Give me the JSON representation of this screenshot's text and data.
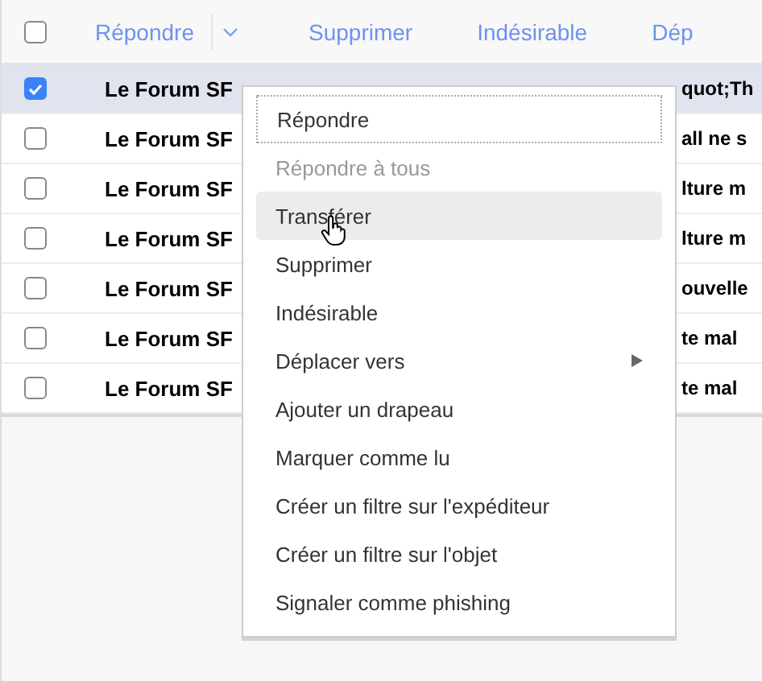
{
  "toolbar": {
    "select_all": {
      "checked": false
    },
    "actions": [
      {
        "label": "Répondre",
        "kind": "split"
      },
      {
        "label": "Supprimer",
        "kind": "plain"
      },
      {
        "label": "Indésirable",
        "kind": "plain"
      },
      {
        "label": "Dép",
        "kind": "plain"
      }
    ]
  },
  "messages": [
    {
      "sender": "Le Forum SF",
      "subject": "quot;Th",
      "selected": true
    },
    {
      "sender": "Le Forum SF",
      "subject": "all ne s",
      "selected": false
    },
    {
      "sender": "Le Forum SF",
      "subject": "lture m",
      "selected": false
    },
    {
      "sender": "Le Forum SF",
      "subject": "lture m",
      "selected": false
    },
    {
      "sender": "Le Forum SF",
      "subject": "ouvelle",
      "selected": false
    },
    {
      "sender": "Le Forum SF",
      "subject": "te mal",
      "selected": false
    },
    {
      "sender": "Le Forum SF",
      "subject": "te mal",
      "selected": false
    }
  ],
  "context_menu": {
    "items": [
      {
        "label": "Répondre",
        "disabled": false,
        "focused": true,
        "hovered": false,
        "submenu": false
      },
      {
        "label": "Répondre à tous",
        "disabled": true,
        "focused": false,
        "hovered": false,
        "submenu": false
      },
      {
        "label": "Transférer",
        "disabled": false,
        "focused": false,
        "hovered": true,
        "submenu": false
      },
      {
        "label": "Supprimer",
        "disabled": false,
        "focused": false,
        "hovered": false,
        "submenu": false
      },
      {
        "label": "Indésirable",
        "disabled": false,
        "focused": false,
        "hovered": false,
        "submenu": false
      },
      {
        "label": "Déplacer vers",
        "disabled": false,
        "focused": false,
        "hovered": false,
        "submenu": true
      },
      {
        "label": "Ajouter un drapeau",
        "disabled": false,
        "focused": false,
        "hovered": false,
        "submenu": false
      },
      {
        "label": "Marquer comme lu",
        "disabled": false,
        "focused": false,
        "hovered": false,
        "submenu": false
      },
      {
        "label": "Créer un filtre sur l'expéditeur",
        "disabled": false,
        "focused": false,
        "hovered": false,
        "submenu": false
      },
      {
        "label": "Créer un filtre sur l'objet",
        "disabled": false,
        "focused": false,
        "hovered": false,
        "submenu": false
      },
      {
        "label": "Signaler comme phishing",
        "disabled": false,
        "focused": false,
        "hovered": false,
        "submenu": false
      }
    ]
  }
}
